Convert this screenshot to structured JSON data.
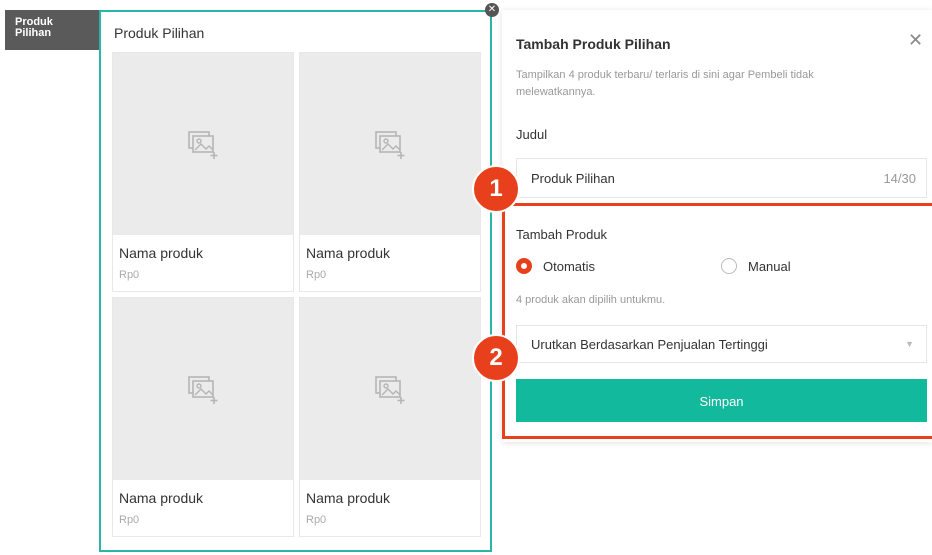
{
  "tag": {
    "line1": "Produk",
    "line2": "Pilihan"
  },
  "preview": {
    "title": "Produk Pilihan",
    "products": [
      {
        "name": "Nama produk",
        "price": "Rp0"
      },
      {
        "name": "Nama produk",
        "price": "Rp0"
      },
      {
        "name": "Nama produk",
        "price": "Rp0"
      },
      {
        "name": "Nama produk",
        "price": "Rp0"
      }
    ]
  },
  "panel": {
    "title": "Tambah Produk Pilihan",
    "description": "Tampilkan 4 produk terbaru/ terlaris di sini agar Pembeli tidak melewatkannya.",
    "judul_label": "Judul",
    "judul_value": "Produk Pilihan",
    "judul_counter": "14/30",
    "tambah_label": "Tambah Produk",
    "radio_auto": "Otomatis",
    "radio_manual": "Manual",
    "hint": "4 produk akan dipilih untukmu.",
    "sort_value": "Urutkan Berdasarkan Penjualan Tertinggi",
    "save_label": "Simpan"
  },
  "badges": [
    "1",
    "2"
  ],
  "colors": {
    "accent_red": "#e8401c",
    "accent_teal": "#13b99d",
    "preview_border": "#2bb5a8"
  }
}
